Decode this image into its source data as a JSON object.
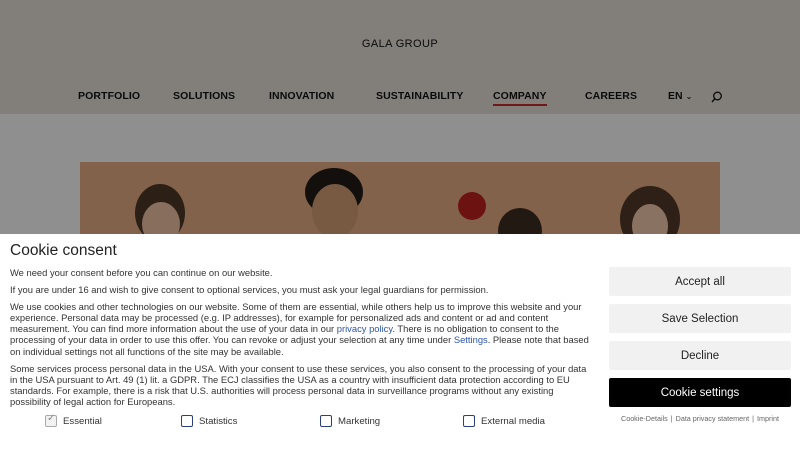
{
  "header": {
    "brand": "GALA GROUP",
    "nav": [
      "PORTFOLIO",
      "SOLUTIONS",
      "INNOVATION",
      "SUSTAINABILITY",
      "COMPANY",
      "CAREERS"
    ],
    "active_nav": "COMPANY",
    "language": "EN",
    "search_icon": "search-icon",
    "chevron_icon": "chevron-down-icon"
  },
  "colors": {
    "accent": "#b22a2a",
    "link": "#2b55a8",
    "hero_background": "#d9a47c",
    "dark_button": "#000000"
  },
  "consent": {
    "title": "Cookie consent",
    "intro": "We need your consent before you can continue on our website.",
    "minors": "If you are under 16 and wish to give consent to optional services, you must ask your legal guardians for permission.",
    "body_part1": "We use cookies and other technologies on our website. Some of them are essential, while others help us to improve this website and your experience. Personal data may be processed (e.g. IP addresses), for example for personalized ads and content or ad and content measurement. You can find more information about the use of your data in our ",
    "privacy_link": "privacy policy",
    "body_part2": ". There is no obligation to consent to the processing of your data in order to use this offer. You can revoke or adjust your selection at any time under ",
    "settings_link": "Settings",
    "body_part3": ". Please note that based on individual settings not all functions of the site may be available.",
    "usa": "Some services process personal data in the USA. With your consent to use these services, you also consent to the processing of your data in the USA pursuant to Art. 49 (1) lit. a GDPR. The ECJ classifies the USA as a country with insufficient data protection according to EU standards. For example, there is a risk that U.S. authorities will process personal data in surveillance programs without any existing possibility of legal action for Europeans.",
    "options": [
      {
        "label": "Essential",
        "checked": true,
        "disabled": true
      },
      {
        "label": "Statistics",
        "checked": false
      },
      {
        "label": "Marketing",
        "checked": false
      },
      {
        "label": "External media",
        "checked": false
      }
    ],
    "buttons": {
      "accept_all": "Accept all",
      "save_selection": "Save Selection",
      "decline": "Decline",
      "cookie_settings": "Cookie settings"
    },
    "footer_links": {
      "cookie_details": "Cookie-Details",
      "privacy_statement": "Data privacy statement",
      "imprint": "Imprint",
      "separator": "|"
    }
  }
}
